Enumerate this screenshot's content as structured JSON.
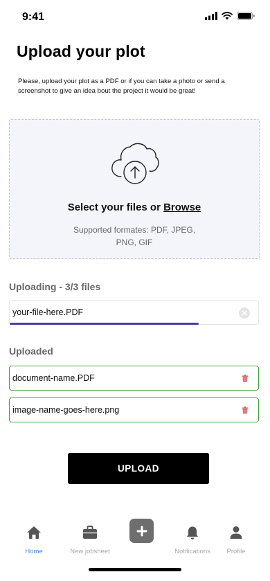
{
  "status_bar": {
    "time": "9:41"
  },
  "header": {
    "title": "Upload your plot",
    "description": "Please, upload your plot as a PDF or if you can take a photo or send a screenshot to give an idea bout the project it would be great!"
  },
  "dropzone": {
    "title_prefix": "Select your files or ",
    "browse_label": "Browse",
    "supported_line1": "Supported formates: PDF, JPEG,",
    "supported_line2": "PNG, GIF",
    "icon": "cloud-upload-icon"
  },
  "uploading": {
    "label": "Uploading - 3/3 files",
    "file": {
      "name": "your-file-here.PDF",
      "progress": 0.76
    },
    "progress_color": "#4b3ca7"
  },
  "uploaded": {
    "label": "Uploaded",
    "files": [
      {
        "name": "document-name.PDF"
      },
      {
        "name": "image-name-goes-here.png"
      }
    ],
    "border_color": "#3aa83a",
    "delete_icon_color": "#e05a5a"
  },
  "actions": {
    "upload_label": "UPLOAD"
  },
  "tab_bar": {
    "tabs": [
      {
        "label": "Home",
        "icon": "home-icon",
        "active": true
      },
      {
        "label": "New jobsheet",
        "icon": "briefcase-icon",
        "active": false
      },
      {
        "label": "",
        "icon": "plus-icon",
        "active": false
      },
      {
        "label": "Notifications",
        "icon": "bell-icon",
        "active": false
      },
      {
        "label": "Profile",
        "icon": "person-icon",
        "active": false
      }
    ],
    "active_color": "#3f87e8",
    "inactive_color": "#a8a8a8"
  }
}
